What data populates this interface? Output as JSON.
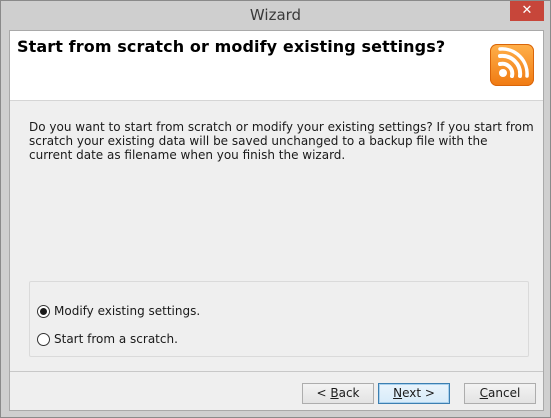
{
  "window": {
    "title": "Wizard",
    "close_glyph": "✕"
  },
  "header": {
    "title": "Start from scratch or modify existing settings?",
    "logo_icon": "rss-feed-logo-icon",
    "accent": "#f28a1a"
  },
  "description": "Do you want to start from scratch or modify your existing settings? If you start from scratch your existing data will be saved unchanged to a backup file with the current date as filename when you finish the wizard.",
  "options": [
    {
      "label": "Modify existing settings.",
      "checked": true
    },
    {
      "label": "Start from a scratch.",
      "checked": false
    }
  ],
  "buttons": {
    "back_mnemonic": "B",
    "back_rest": "ack",
    "back_prefix": "< ",
    "next_mnemonic": "N",
    "next_rest": "ext >",
    "cancel_mnemonic": "C",
    "cancel_rest": "ancel"
  }
}
